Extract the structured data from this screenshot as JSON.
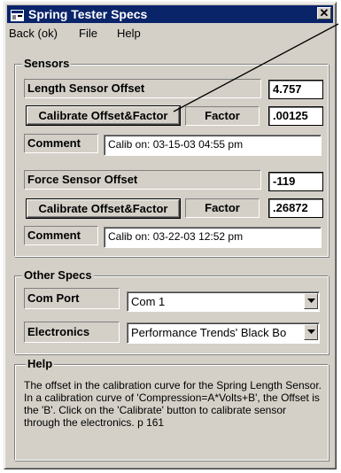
{
  "window": {
    "title": "Spring Tester Specs",
    "close_glyph": "✕"
  },
  "menu": {
    "items": [
      "Back (ok)",
      "File",
      "Help"
    ]
  },
  "sensors": {
    "legend": "Sensors",
    "length": {
      "label": "Length Sensor Offset",
      "offset_value": "4.757",
      "calibrate_button": "Calibrate Offset&Factor",
      "factor_label": "Factor",
      "factor_value": ".00125",
      "comment_label": "Comment",
      "comment_value": "Calib on: 03-15-03  04:55 pm"
    },
    "force": {
      "label": "Force Sensor Offset",
      "offset_value": "-119",
      "calibrate_button": "Calibrate Offset&Factor",
      "factor_label": "Factor",
      "factor_value": ".26872",
      "comment_label": "Comment",
      "comment_value": "Calib on: 03-22-03  12:52 pm"
    }
  },
  "other_specs": {
    "legend": "Other Specs",
    "com_port_label": "Com Port",
    "com_port_value": "Com 1",
    "electronics_label": "Electronics",
    "electronics_value": "Performance Trends' Black Bo"
  },
  "help": {
    "legend": "Help",
    "text": "The offset in the calibration curve for the Spring Length Sensor.  In a calibration curve of 'Compression=A*Volts+B', the Offset is the 'B'.  Click on the 'Calibrate' button to calibrate sensor through the electronics.  p 161"
  },
  "colors": {
    "titlebar": "#0a246a",
    "face": "#d4d0c8"
  }
}
